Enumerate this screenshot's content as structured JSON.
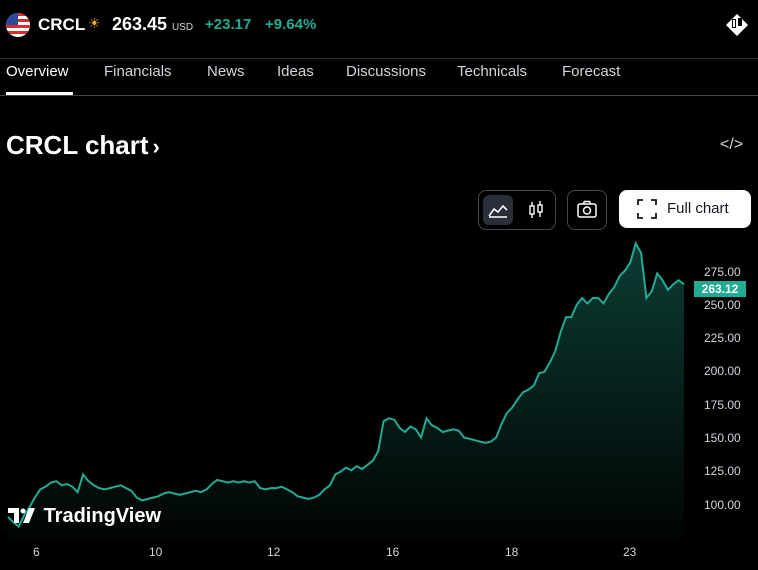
{
  "header": {
    "ticker": "CRCL",
    "price": "263.45",
    "currency": "USD",
    "change": "+23.17",
    "change_percent": "+9.64%",
    "positive_color": "#22ab94",
    "flag_icon": "us-flag-icon",
    "session_icon": "sun-icon",
    "logo_icon": "tradingview-badge-icon"
  },
  "tabs": [
    {
      "label": "Overview",
      "active": true
    },
    {
      "label": "Financials",
      "active": false
    },
    {
      "label": "News",
      "active": false
    },
    {
      "label": "Ideas",
      "active": false
    },
    {
      "label": "Discussions",
      "active": false
    },
    {
      "label": "Technicals",
      "active": false
    },
    {
      "label": "Forecast",
      "active": false
    }
  ],
  "section": {
    "title": "CRCL chart",
    "embed_icon": "code-icon"
  },
  "toolbar": {
    "area_icon": "area-chart-icon",
    "candles_icon": "candlestick-icon",
    "camera_icon": "camera-icon",
    "full_icon": "expand-icon",
    "full_label": "Full chart"
  },
  "brand": {
    "label": "TradingView"
  },
  "chart_data": {
    "type": "area",
    "line_color": "#22ab94",
    "y_ticks": [
      "275.00",
      "250.00",
      "225.00",
      "200.00",
      "175.00",
      "150.00",
      "125.00",
      "100.00"
    ],
    "y_range": [
      86,
      290
    ],
    "x_ticks": [
      {
        "label": "6",
        "i": 4
      },
      {
        "label": "10",
        "i": 24
      },
      {
        "label": "12",
        "i": 44
      },
      {
        "label": "16",
        "i": 64
      },
      {
        "label": "18",
        "i": 84
      },
      {
        "label": "23",
        "i": 104
      }
    ],
    "last_price_label": "263.12",
    "last_value": 263.12,
    "values": [
      92,
      88,
      85,
      93,
      99,
      106,
      112,
      114,
      117,
      118,
      115,
      116,
      114,
      110,
      123,
      118,
      115,
      113,
      112,
      113,
      114,
      115,
      113,
      111,
      106,
      104,
      105,
      106,
      107,
      109,
      110,
      109,
      108,
      109,
      110,
      111,
      110,
      112,
      116,
      119,
      118,
      117,
      118,
      117,
      118,
      117,
      118,
      113,
      112,
      113,
      113,
      114,
      112,
      110,
      107,
      106,
      105,
      106,
      108,
      112,
      115,
      123,
      125,
      128,
      126,
      129,
      127,
      130,
      133,
      140,
      162,
      164,
      163,
      157,
      154,
      158,
      156,
      150,
      164,
      159,
      157,
      154,
      155,
      156,
      155,
      150,
      149,
      148,
      147,
      146,
      147,
      150,
      160,
      168,
      172,
      178,
      183,
      185,
      188,
      197,
      198,
      205,
      213,
      227,
      238,
      238,
      247,
      252,
      248,
      252,
      252,
      248,
      255,
      260,
      268,
      272,
      278,
      292,
      285,
      252,
      257,
      270,
      265,
      258,
      262,
      265,
      262
    ]
  }
}
